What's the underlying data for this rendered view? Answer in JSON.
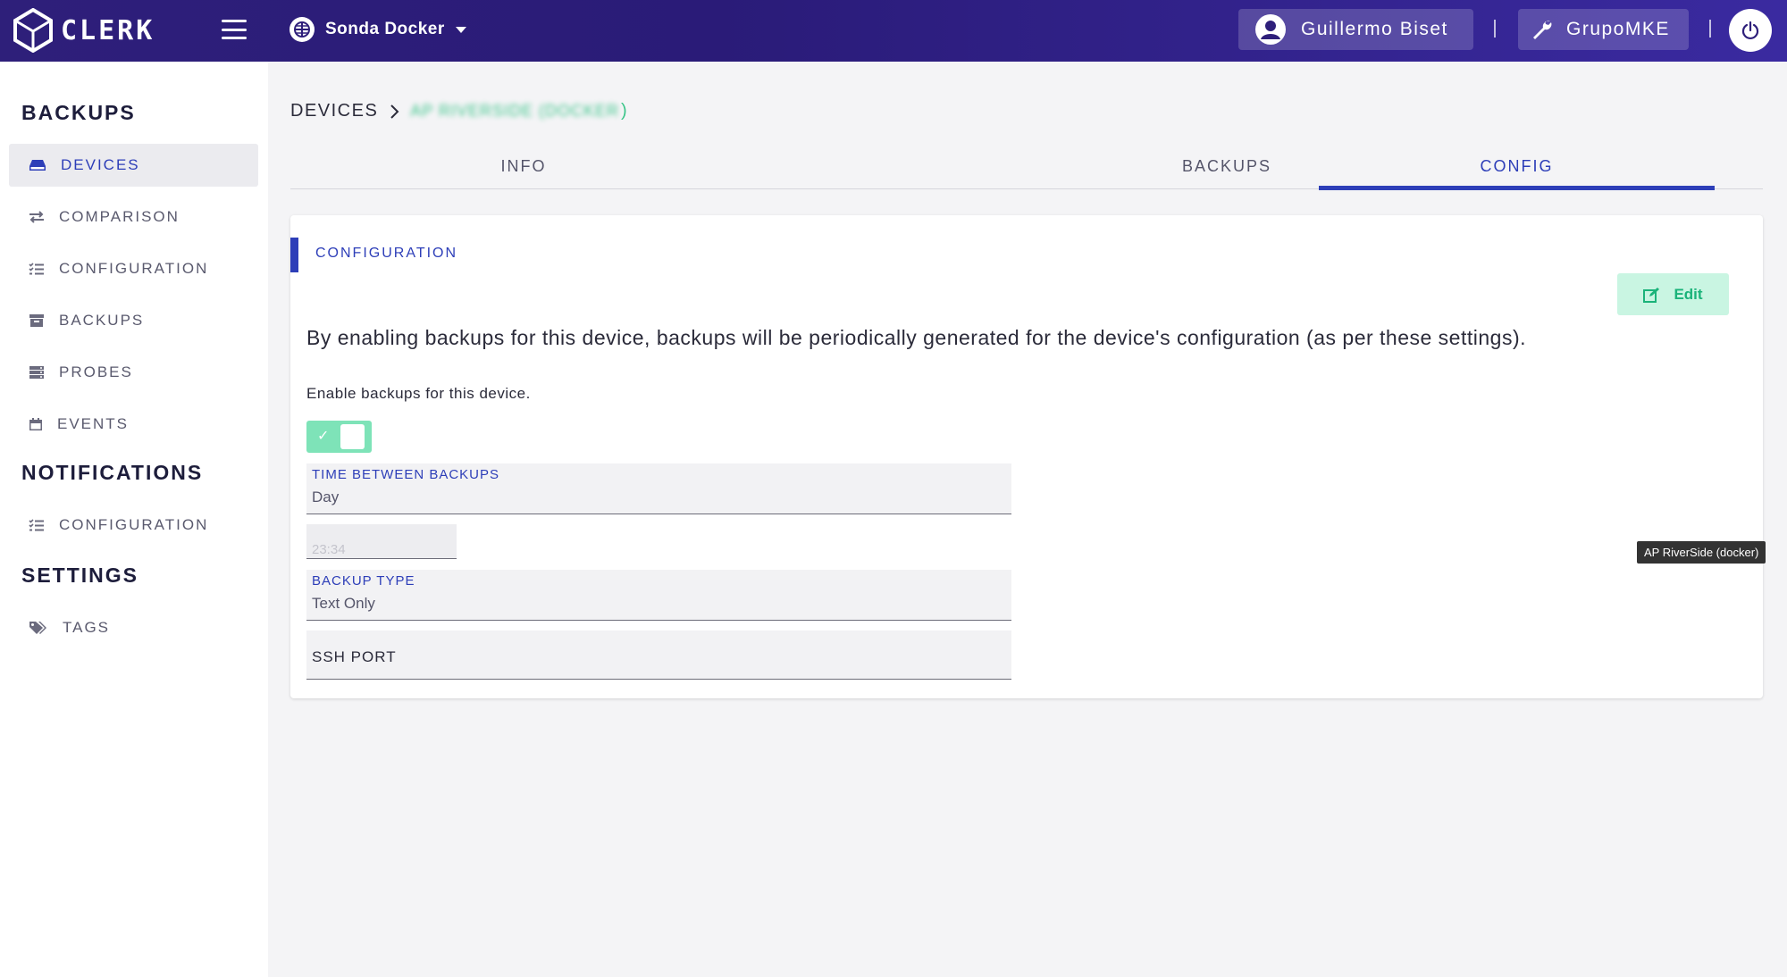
{
  "app": {
    "name": "CLERK",
    "brand_color": "#2e1f7a",
    "accent_color": "#2d3eb8",
    "success_color": "#1bb37a"
  },
  "header": {
    "org_selector": "Sonda Docker",
    "user_name": "Guillermo Biset",
    "organization": "GrupoMKE",
    "icons": [
      "menu-icon",
      "globe-icon",
      "user-avatar-icon",
      "wrench-icon",
      "power-icon"
    ]
  },
  "sidebar": {
    "sections": [
      {
        "title": "BACKUPS",
        "items": [
          {
            "label": "DEVICES",
            "icon": "hdd-icon",
            "active": true
          },
          {
            "label": "COMPARISON",
            "icon": "exchange-icon"
          },
          {
            "label": "CONFIGURATION",
            "icon": "tasks-icon"
          },
          {
            "label": "BACKUPS",
            "icon": "archive-icon"
          },
          {
            "label": "PROBES",
            "icon": "server-icon"
          },
          {
            "label": "EVENTS",
            "icon": "calendar-icon"
          }
        ]
      },
      {
        "title": "NOTIFICATIONS",
        "items": [
          {
            "label": "CONFIGURATION",
            "icon": "tasks-icon"
          }
        ]
      },
      {
        "title": "SETTINGS",
        "items": [
          {
            "label": "TAGS",
            "icon": "tags-icon"
          }
        ]
      }
    ]
  },
  "breadcrumb": {
    "root": "DEVICES",
    "device": "AP RIVERSIDE (DOCKER",
    "close_paren": ")"
  },
  "tabs": [
    {
      "label": "INFO",
      "active": false
    },
    {
      "label": "BACKUPS",
      "active": false
    },
    {
      "label": "CONFIG",
      "active": true
    }
  ],
  "config_card": {
    "title": "CONFIGURATION",
    "edit_label": "Edit",
    "description": "By enabling backups for this device, backups will be periodically generated for the device's configuration (as per these settings).",
    "enable_label": "Enable backups for this device.",
    "enable_checked": true,
    "time_between": {
      "label": "TIME BETWEEN BACKUPS",
      "value": "Day"
    },
    "time_of_day": {
      "value": "23:34"
    },
    "backup_type": {
      "label": "BACKUP TYPE",
      "value": "Text Only"
    },
    "ssh_port": {
      "label": "SSH PORT"
    }
  },
  "tooltip": "AP RiverSide (docker)"
}
